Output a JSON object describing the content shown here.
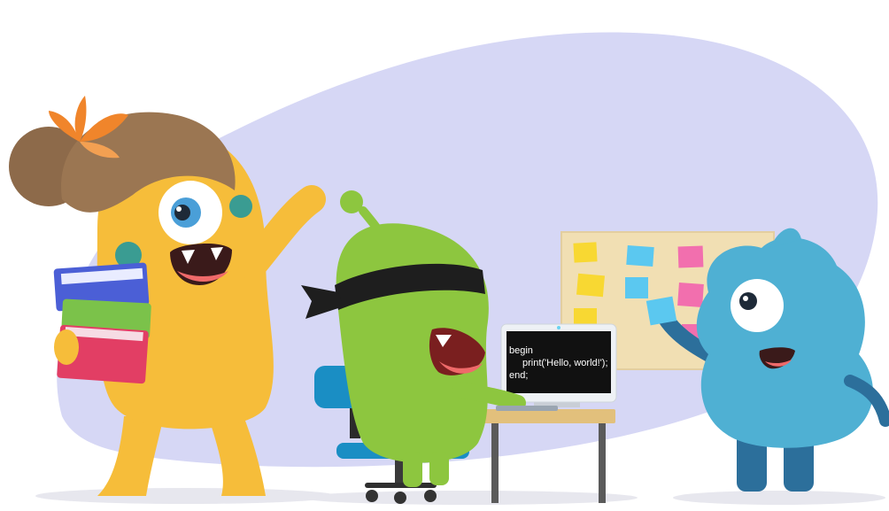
{
  "illustration": {
    "background_blob_color": "#d6d7f5",
    "monitor": {
      "code_lines": [
        "begin",
        "print('Hello, world!');",
        "end;"
      ],
      "screen_color": "#111111"
    },
    "characters": [
      {
        "name": "yellow-monster",
        "color": "#f6bd3a",
        "holding": "books"
      },
      {
        "name": "green-monster",
        "color": "#8dc63f",
        "accessory": "black-headband"
      },
      {
        "name": "blue-monster",
        "color": "#4fb0d3",
        "activity": "sticky-notes"
      }
    ],
    "sticky_note_colors": [
      "#f8d832",
      "#5bc8f0",
      "#f26fae",
      "#9ad14b"
    ]
  }
}
